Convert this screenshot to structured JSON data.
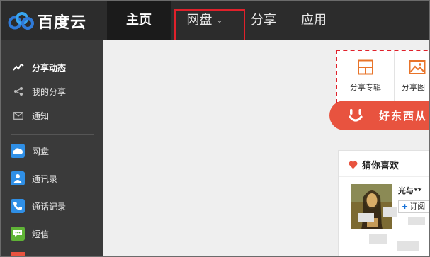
{
  "logo": {
    "text": "百度云"
  },
  "nav": {
    "home": "主页",
    "pan": "网盘",
    "share": "分享",
    "app": "应用"
  },
  "sidebar": {
    "items": [
      {
        "label": "分享动态",
        "icon": "activity-icon"
      },
      {
        "label": "我的分享",
        "icon": "share-icon"
      },
      {
        "label": "通知",
        "icon": "mail-icon"
      },
      {
        "label": "网盘",
        "icon": "cloud-icon"
      },
      {
        "label": "通讯录",
        "icon": "contact-icon"
      },
      {
        "label": "通话记录",
        "icon": "call-log-icon"
      },
      {
        "label": "短信",
        "icon": "sms-icon"
      }
    ]
  },
  "apps": {
    "tile1": "分享专辑",
    "tile2": "分享图"
  },
  "banner": {
    "text": "好东西从"
  },
  "recommend": {
    "title": "猜你喜欢",
    "item_name": "光与**",
    "subscribe": "订阅"
  },
  "colors": {
    "topbar": "#2c2c2c",
    "sidebar": "#3a3a3a",
    "accent_orange": "#e8533f",
    "highlight_red": "#e0212b",
    "logo_blue": "#2f7ad8"
  }
}
